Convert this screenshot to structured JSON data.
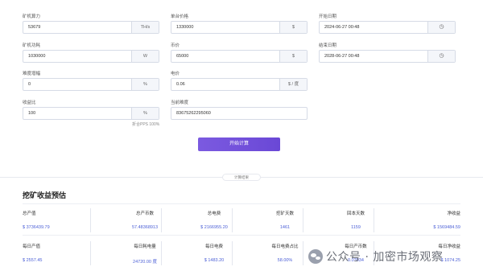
{
  "form": {
    "hashrate": {
      "label": "矿机算力",
      "value": "53679",
      "unit": "TH/s"
    },
    "unit_price": {
      "label": "单台价格",
      "value": "1330000",
      "unit": "$"
    },
    "start_date": {
      "label": "开始日期",
      "value": "2024-06-27 00:48",
      "icon": "clock-icon"
    },
    "power": {
      "label": "矿机功耗",
      "value": "1030000",
      "unit": "W"
    },
    "coin_price": {
      "label": "币价",
      "value": "65000",
      "unit": "$"
    },
    "end_date": {
      "label": "结束日期",
      "value": "2028-06-27 00:48",
      "icon": "clock-icon"
    },
    "difficulty_growth": {
      "label": "难度增幅",
      "value": "0",
      "unit": "%"
    },
    "electricity": {
      "label": "电价",
      "value": "0.06",
      "unit": "$ / 度"
    },
    "revenue_ratio": {
      "label": "收益比",
      "value": "100",
      "unit": "%",
      "note": "折合PPS 100%"
    },
    "current_difficulty": {
      "label": "当前难度",
      "value": "83675262295060"
    }
  },
  "actions": {
    "calculate_label": "开始计算"
  },
  "divider": {
    "label": "计算结果"
  },
  "results": {
    "title": "挖矿收益预估",
    "row1": [
      {
        "label": "总产值",
        "value": "$ 3736439.79"
      },
      {
        "label": "总产币数",
        "value": "57.48368913"
      },
      {
        "label": "总电费",
        "value": "$ 2166955.20"
      },
      {
        "label": "挖矿天数",
        "value": "1461"
      },
      {
        "label": "回本天数",
        "value": "1159"
      },
      {
        "label": "净收益",
        "value": "$ 1569484.59"
      }
    ],
    "row2": [
      {
        "label": "每日产值",
        "value": "$ 2557.45"
      },
      {
        "label": "每日耗电量",
        "value": "24720.00 度"
      },
      {
        "label": "每日电费",
        "value": "$ 1483.20"
      },
      {
        "label": "每日电费占比",
        "value": "58.00%"
      },
      {
        "label": "每日产币数",
        "value": "0.03934"
      },
      {
        "label": "每日净收益",
        "value": "$ 1074.25"
      }
    ]
  },
  "watermark": {
    "text": "公众号 · 加密市场观察"
  }
}
